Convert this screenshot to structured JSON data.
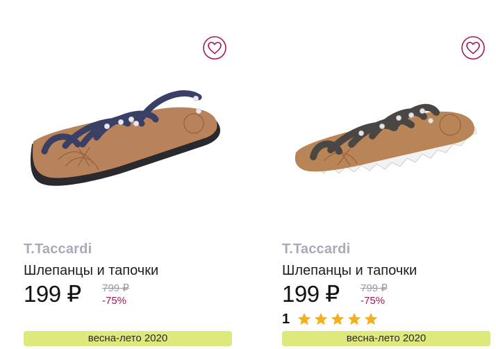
{
  "products": [
    {
      "brand": "T.Taccardi",
      "title": "Шлепанцы и тапочки",
      "price": "199 ₽",
      "old_price": "799 ₽",
      "discount": "-75%",
      "season_badge": "весна-лето 2020",
      "favorite_icon": "heart-outline-icon",
      "accent_color": "#a3165a"
    },
    {
      "brand": "T.Taccardi",
      "title": "Шлепанцы и тапочки",
      "price": "199 ₽",
      "old_price": "799 ₽",
      "discount": "-75%",
      "rating_count": "1",
      "rating_stars": 5,
      "season_badge": "весна-лето 2020",
      "favorite_icon": "heart-outline-icon",
      "accent_color": "#a3165a"
    }
  ],
  "colors": {
    "star": "#f5b01f",
    "badge_background": "#dde97c",
    "brand": "#a9a9b7"
  }
}
